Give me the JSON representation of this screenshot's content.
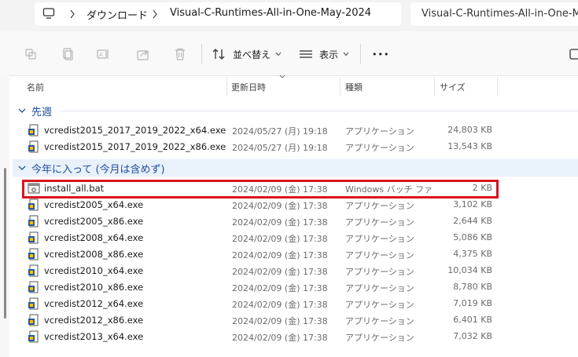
{
  "address_bar": {
    "crumbs": [
      "ダウンロード",
      "Visual-C-Runtimes-All-in-One-May-2024"
    ],
    "search_placeholder": "Visual-C-Runtimes-All-in-One-M"
  },
  "toolbar": {
    "sort_label": "並べ替え",
    "view_label": "表示",
    "more_label": "•••"
  },
  "columns": {
    "name": "名前",
    "date": "更新日時",
    "type": "種類",
    "size": "サイズ"
  },
  "groups": [
    {
      "label": "先週",
      "rows": [
        {
          "name": "vcredist2015_2017_2019_2022_x64.exe",
          "date": "2024/05/27 (月) 19:18",
          "type": "アプリケーション",
          "size": "24,803 KB"
        },
        {
          "name": "vcredist2015_2017_2019_2022_x86.exe",
          "date": "2024/05/27 (月) 19:18",
          "type": "アプリケーション",
          "size": "13,543 KB"
        }
      ]
    },
    {
      "label": "今年に入って (今月は含めず)",
      "rows": [
        {
          "name": "install_all.bat",
          "date": "2024/02/09 (金) 17:38",
          "type": "Windows バッチ ファ...",
          "size": "2 KB"
        },
        {
          "name": "vcredist2005_x64.exe",
          "date": "2024/02/09 (金) 17:38",
          "type": "アプリケーション",
          "size": "3,102 KB"
        },
        {
          "name": "vcredist2005_x86.exe",
          "date": "2024/02/09 (金) 17:38",
          "type": "アプリケーション",
          "size": "2,644 KB"
        },
        {
          "name": "vcredist2008_x64.exe",
          "date": "2024/02/09 (金) 17:38",
          "type": "アプリケーション",
          "size": "5,086 KB"
        },
        {
          "name": "vcredist2008_x86.exe",
          "date": "2024/02/09 (金) 17:38",
          "type": "アプリケーション",
          "size": "4,375 KB"
        },
        {
          "name": "vcredist2010_x64.exe",
          "date": "2024/02/09 (金) 17:38",
          "type": "アプリケーション",
          "size": "10,034 KB"
        },
        {
          "name": "vcredist2010_x86.exe",
          "date": "2024/02/09 (金) 17:38",
          "type": "アプリケーション",
          "size": "8,780 KB"
        },
        {
          "name": "vcredist2012_x64.exe",
          "date": "2024/02/09 (金) 17:38",
          "type": "アプリケーション",
          "size": "7,019 KB"
        },
        {
          "name": "vcredist2012_x86.exe",
          "date": "2024/02/09 (金) 17:38",
          "type": "アプリケーション",
          "size": "6,401 KB"
        },
        {
          "name": "vcredist2013_x64.exe",
          "date": "2024/02/09 (金) 17:38",
          "type": "アプリケーション",
          "size": "7,032 KB"
        }
      ]
    }
  ],
  "highlight_color": "#d9141f",
  "group_color": "#1f4e9c"
}
